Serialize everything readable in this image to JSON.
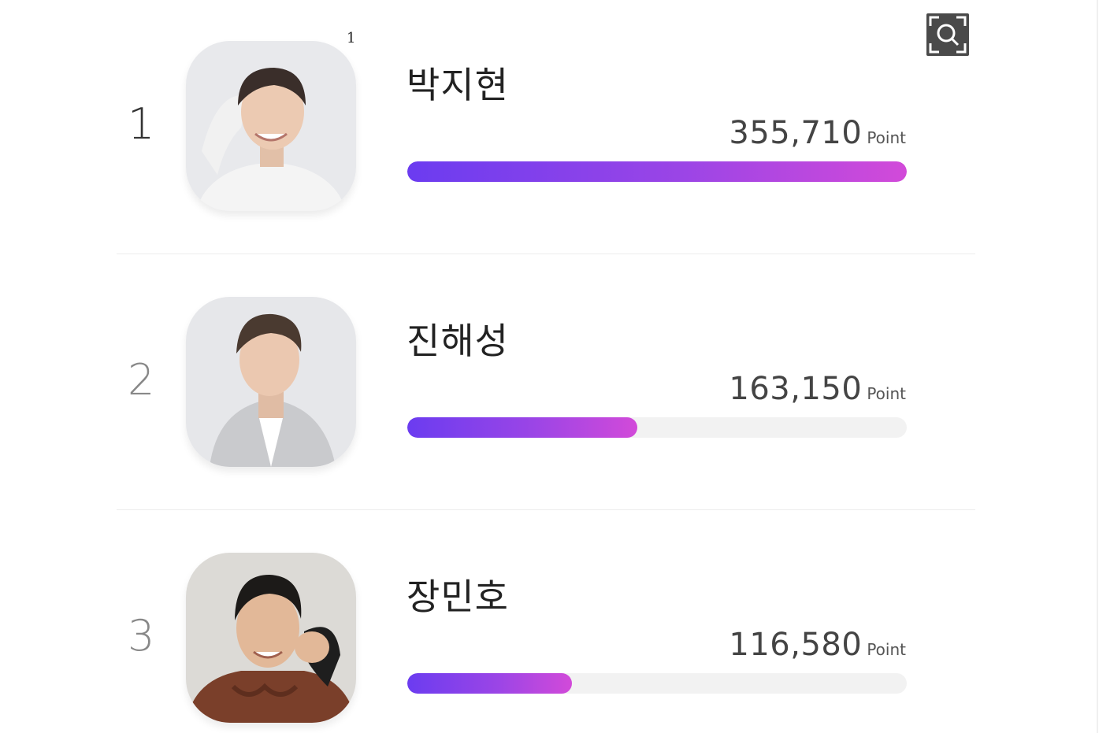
{
  "badge_label": "1",
  "zoom_button": {
    "icon": "zoom-search-icon"
  },
  "point_unit": "Point",
  "colors": {
    "gradient_start": "#6b3cf0",
    "gradient_end": "#d24ad9",
    "track": "#f2f2f2"
  },
  "rankings": [
    {
      "rank": "1",
      "name": "박지현",
      "score": "355,710",
      "progress": 1.0
    },
    {
      "rank": "2",
      "name": "진해성",
      "score": "163,150",
      "progress": 0.46
    },
    {
      "rank": "3",
      "name": "장민호",
      "score": "116,580",
      "progress": 0.33
    }
  ]
}
